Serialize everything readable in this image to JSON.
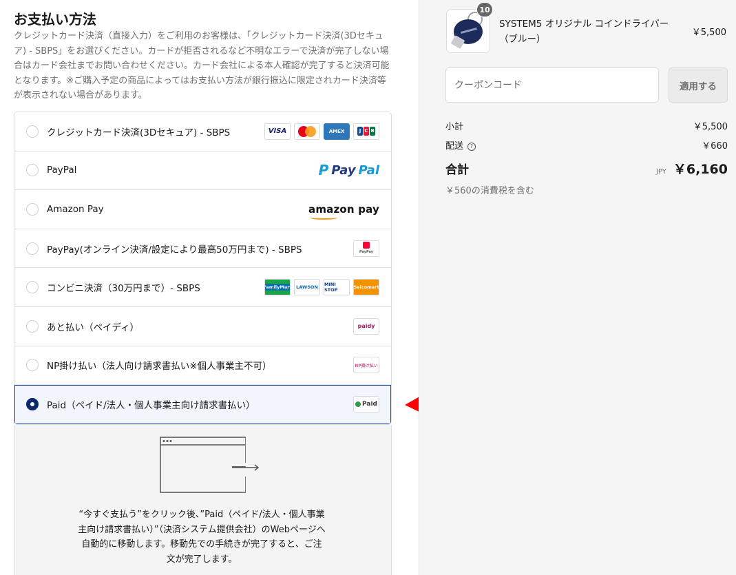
{
  "payment": {
    "title": "お支払い方法",
    "description": "クレジットカード決済（直接入力）をご利用のお客様は、「クレジットカード決済(3Dセキュア) - SBPS」をお選びください。カードが拒否されるなど不明なエラーで決済が完了しない場合はカード会社までお問い合わせください。カード会社による本人確認が完了すると決済可能となります。※ご購入予定の商品によってはお支払い方法が銀行振込に限定されカード決済等が表示されない場合があります。",
    "methods": [
      {
        "label": "クレジットカード決済(3Dセキュア) - SBPS",
        "selected": false,
        "badges": [
          "VISA",
          "Mastercard",
          "AMEX",
          "JCB"
        ]
      },
      {
        "label": "PayPal",
        "selected": false,
        "badges": [
          "PayPal"
        ]
      },
      {
        "label": "Amazon Pay",
        "selected": false,
        "badges": [
          "amazon pay"
        ]
      },
      {
        "label": "PayPay(オンライン決済/設定により最高50万円まで) - SBPS",
        "selected": false,
        "badges": [
          "PayPay"
        ]
      },
      {
        "label": "コンビニ決済（30万円まで）- SBPS",
        "selected": false,
        "badges": [
          "FamilyMart",
          "LAWSON",
          "MINI STOP",
          "Seicomart"
        ]
      },
      {
        "label": "あと払い（ペイディ）",
        "selected": false,
        "badges": [
          "paidy"
        ]
      },
      {
        "label": "NP掛け払い（法人向け請求書払い※個人事業主不可）",
        "selected": false,
        "badges": [
          "NP掛け払い"
        ]
      },
      {
        "label": "Paid（ペイド/法人・個人事業主向け請求書払い）",
        "selected": true,
        "badges": [
          "Paid"
        ]
      }
    ],
    "redirect_text": "“今すぐ支払う”をクリック後、”Paid（ペイド/法人・個人事業主向け請求書払い）”（決済システム提供会社）のWebページへ自動的に移動します。移動先での手続きが完了すると、ご注文が完了します。"
  },
  "order": {
    "item": {
      "name": "SYSTEM5 オリジナル コインドライバー（ブルー）",
      "quantity": "10",
      "price": "￥5,500"
    },
    "coupon": {
      "placeholder": "クーポンコード",
      "button": "適用する"
    },
    "subtotal_label": "小計",
    "subtotal": "￥5,500",
    "shipping_label": "配送",
    "shipping": "￥660",
    "total_label": "合計",
    "currency": "JPY",
    "total": "￥6,160",
    "tax_note": "￥560の消費税を含む"
  },
  "colors": {
    "selected_border": "#1e4aa8",
    "selected_bg": "#f2f6fc",
    "radio_selected": "#0b2a6b",
    "arrow": "#ff0000"
  }
}
